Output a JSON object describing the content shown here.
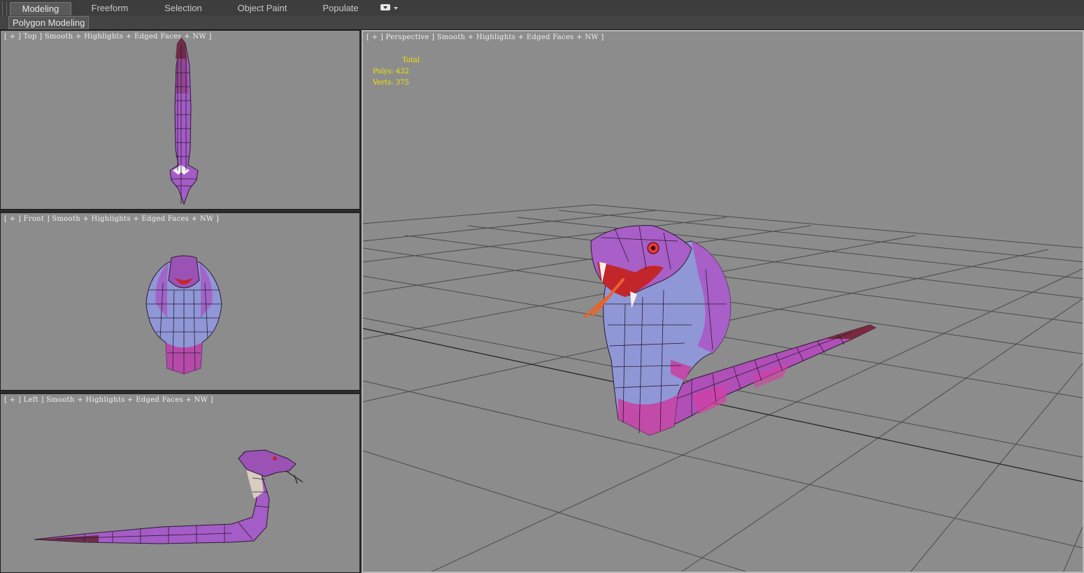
{
  "ribbon": {
    "tabs": [
      {
        "label": "Modeling",
        "active": true
      },
      {
        "label": "Freeform",
        "active": false
      },
      {
        "label": "Selection",
        "active": false
      },
      {
        "label": "Object Paint",
        "active": false
      },
      {
        "label": "Populate",
        "active": false
      }
    ],
    "panel_label": "Polygon Modeling",
    "dropdown_icon": "ribbon-options-icon"
  },
  "viewports": {
    "top": {
      "label": "[ + ] Top ] Smooth + Highlights + Edged Faces + NW ]"
    },
    "front": {
      "label": "[ + ] Front ] Smooth + Highlights + Edged Faces + NW ]"
    },
    "left": {
      "label": "[ + ] Left ] Smooth + Highlights + Edged Faces + NW ]"
    },
    "perspective": {
      "label": "[ + ] Perspective ] Smooth + Highlights + Edged Faces + NW ]",
      "stats": {
        "header": "Total",
        "polys_label": "Polys:",
        "polys_value": "432",
        "verts_label": "Verts:",
        "verts_value": "375"
      }
    }
  },
  "colors": {
    "viewport_bg": "#8c8c8c",
    "stats_text": "#f3e500",
    "snake_body": "#a85fc7",
    "snake_belly": "#8f97d6",
    "snake_mouth": "#c2262a"
  }
}
